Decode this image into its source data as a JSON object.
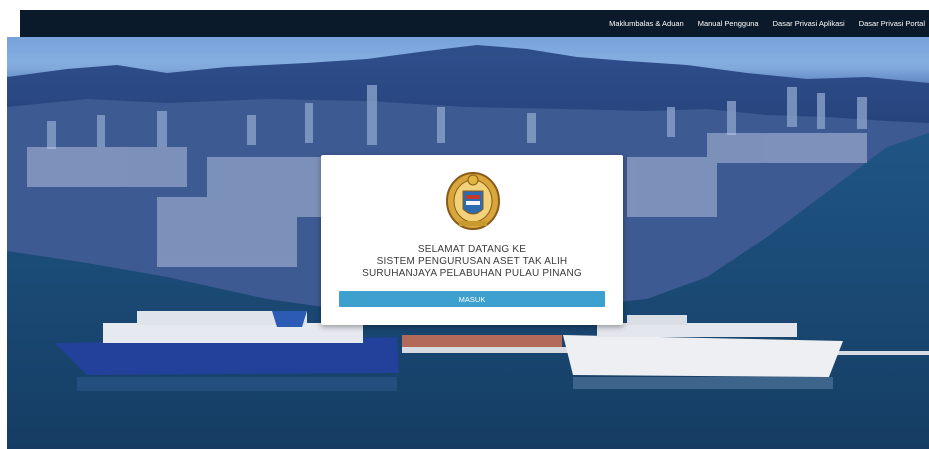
{
  "nav": {
    "items": [
      {
        "label": "Maklumbalas & Aduan"
      },
      {
        "label": "Manual Pengguna"
      },
      {
        "label": "Dasar Privasi Aplikasi"
      },
      {
        "label": "Dasar Privasi Portal"
      }
    ]
  },
  "login_card": {
    "line1": "SELAMAT DATANG KE",
    "line2": "SISTEM PENGURUSAN ASET TAK ALIH",
    "line3": "SURUHANJAYA PELABUHAN PULAU PINANG",
    "button_label": "MASUK",
    "emblem_icon": "coat-of-arms-icon"
  },
  "colors": {
    "topbar": "#0b1a2b",
    "button": "#3ea0cf",
    "text": "#3a3a3a"
  }
}
